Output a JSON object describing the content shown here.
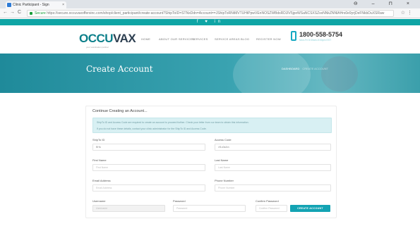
{
  "browser": {
    "tab_title": "Clinic Participant - Sign",
    "tab_close": "×",
    "window_controls": "⊖ – ⊓ ×",
    "nav_back": "←",
    "nav_forward": "→",
    "nav_reload": "C",
    "secure_label": "Secure",
    "url": "https://secure.occuvaxoffersinc.com/shop/client_participant/create-account?ShipToID=STNxDdn=Account==JShipToRNtMVTUHtPpwVEnNOSZWBdsRDJlV5jpxWSaNCSXSZsxNNkZNNlAHrs0e9yrjDeFNkbDuXSRaw",
    "bookmark_icon": "☆",
    "menu_icon": "⋮"
  },
  "social_icons": "f  ♥  in",
  "header": {
    "logo_part1": "OCCU",
    "logo_part2": "VAX",
    "logo_tagline": "your vaccination partner",
    "nav": [
      "HOME",
      "ABOUT OUR SERVICES",
      "SERVICES",
      "SERVICE AREAS",
      "BLOG",
      "REGISTER NOW"
    ],
    "phone": "1800-558-5754",
    "phone_caption": "Mon-Fri 8:00am-5:00pm EST"
  },
  "hero": {
    "title": "Create Account",
    "breadcrumb_home": "DASHBOARD",
    "breadcrumb_current": "CREATE ACCOUNT"
  },
  "form": {
    "heading": "Continue Creating an Account...",
    "info_line_1": "ShipTo ID and Access Code are required to create an account to proceed further. Check your letter from our team to obtain this information.",
    "info_line_2": "If you do not have these details, contact your clinic administrator for the ShipTo ID and Access Code.",
    "fields": {
      "shipto_id": {
        "label": "ShipTo ID",
        "value": "ВНЬ"
      },
      "access_code": {
        "label": "Access Code",
        "value": "vf1u0sAm"
      },
      "first_name": {
        "label": "First Name",
        "placeholder": "First Name"
      },
      "last_name": {
        "label": "Last Name",
        "placeholder": "Last Name"
      },
      "email": {
        "label": "Email Address",
        "placeholder": "Email Address"
      },
      "phone": {
        "label": "Phone Number",
        "placeholder": "Phone Number"
      },
      "username": {
        "label": "Username",
        "placeholder": "Username"
      },
      "password": {
        "label": "Password",
        "placeholder": "Password"
      },
      "confirm_password": {
        "label": "Confirm Password",
        "placeholder": "Confirm Password"
      }
    },
    "submit_label": "CREATE ACCOUNT"
  }
}
